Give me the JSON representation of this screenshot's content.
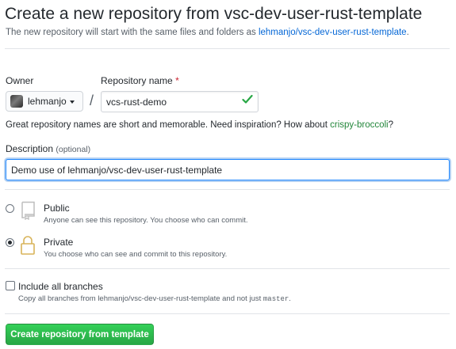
{
  "header": {
    "title": "Create a new repository from vsc-dev-user-rust-template",
    "subtitle_prefix": "The new repository will start with the same files and folders as",
    "template_link": "lehmanjo/vsc-dev-user-rust-template",
    "subtitle_suffix": "."
  },
  "owner": {
    "label": "Owner",
    "name": "lehmanjo"
  },
  "repo_name": {
    "label": "Repository name",
    "required_marker": "*",
    "value": "vcs-rust-demo",
    "separator": "/"
  },
  "hint": {
    "text": "Great repository names are short and memorable. Need inspiration? How about",
    "suggestion": "crispy-broccoli",
    "suffix": "?"
  },
  "description": {
    "label": "Description",
    "optional": "(optional)",
    "value": "Demo use of lehmanjo/vsc-dev-user-rust-template"
  },
  "visibility": {
    "public": {
      "title": "Public",
      "desc": "Anyone can see this repository. You choose who can commit.",
      "selected": false
    },
    "private": {
      "title": "Private",
      "desc": "You choose who can see and commit to this repository.",
      "selected": true
    }
  },
  "branches": {
    "label": "Include all branches",
    "desc_prefix": "Copy all branches from lehmanjo/vsc-dev-user-rust-template and not just",
    "desc_code": "master",
    "desc_suffix": ".",
    "checked": false
  },
  "submit": {
    "label": "Create repository from template"
  },
  "colors": {
    "link": "#0366d6",
    "success": "#28a745",
    "suggestion": "#22863a",
    "required": "#cb2431",
    "focus": "#2188ff"
  },
  "icons": [
    "avatar",
    "chevron-down-icon",
    "check-icon",
    "repo-icon",
    "lock-icon"
  ]
}
